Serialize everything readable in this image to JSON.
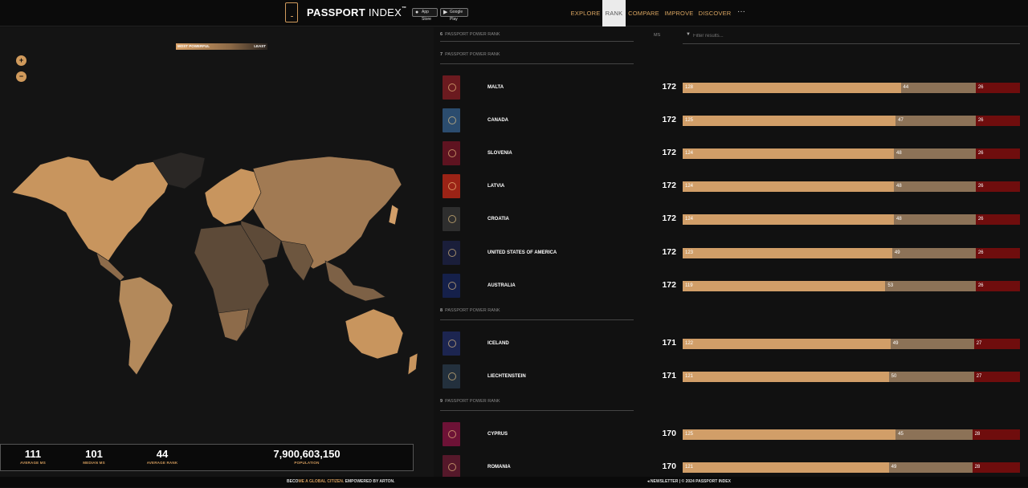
{
  "header": {
    "logo_main": "PASSPORT",
    "logo_light": " INDEX",
    "logo_tm": "™",
    "app_store": "App Store",
    "google_play": "Google Play",
    "nav": [
      "EXPLORE",
      "RANK",
      "COMPARE",
      "IMPROVE",
      "DISCOVER"
    ],
    "nav_active": "RANK",
    "more": "···"
  },
  "map": {
    "zoom_in": "+",
    "zoom_out": "−",
    "legend_left": "MOST POWERFUL",
    "legend_right": "LEAST"
  },
  "stats": [
    {
      "value": "111",
      "label": "AVERAGE MS"
    },
    {
      "value": "101",
      "label": "MEDIAN MS"
    },
    {
      "value": "44",
      "label": "AVERAGE RANK"
    },
    {
      "value": "7,900,603,150",
      "label": "POPULATION"
    }
  ],
  "rank": {
    "ms_header": "MS",
    "filter_placeholder": "Filter results...",
    "groups": [
      {
        "rank": "6",
        "label": "PASSPORT POWER RANK"
      },
      {
        "rank": "7",
        "label": "PASSPORT POWER RANK"
      },
      {
        "rank": "8",
        "label": "PASSPORT POWER RANK"
      },
      {
        "rank": "9",
        "label": "PASSPORT POWER RANK"
      }
    ],
    "rows": [
      {
        "country": "MALTA",
        "ms": "172",
        "vf": "128",
        "va": "44",
        "vr": "26",
        "color": "#6b1a1f"
      },
      {
        "country": "CANADA",
        "ms": "172",
        "vf": "125",
        "va": "47",
        "vr": "26",
        "color": "#2b4c6e"
      },
      {
        "country": "SLOVENIA",
        "ms": "172",
        "vf": "124",
        "va": "48",
        "vr": "26",
        "color": "#5e1320"
      },
      {
        "country": "LATVIA",
        "ms": "172",
        "vf": "124",
        "va": "48",
        "vr": "26",
        "color": "#9b2316"
      },
      {
        "country": "CROATIA",
        "ms": "172",
        "vf": "124",
        "va": "48",
        "vr": "26",
        "color": "#2e2e2e"
      },
      {
        "country": "UNITED STATES OF AMERICA",
        "ms": "172",
        "vf": "123",
        "va": "49",
        "vr": "26",
        "color": "#1a1e3a"
      },
      {
        "country": "AUSTRALIA",
        "ms": "172",
        "vf": "119",
        "va": "53",
        "vr": "26",
        "color": "#15204a"
      },
      {
        "country": "ICELAND",
        "ms": "171",
        "vf": "122",
        "va": "49",
        "vr": "27",
        "color": "#1c2550"
      },
      {
        "country": "LIECHTENSTEIN",
        "ms": "171",
        "vf": "121",
        "va": "50",
        "vr": "27",
        "color": "#23303d"
      },
      {
        "country": "CYPRUS",
        "ms": "170",
        "vf": "125",
        "va": "45",
        "vr": "28",
        "color": "#6d1236"
      },
      {
        "country": "ROMANIA",
        "ms": "170",
        "vf": "121",
        "va": "49",
        "vr": "28",
        "color": "#55182a"
      }
    ]
  },
  "footer": {
    "become_pre": "BECO",
    "become_hl": "ME A GLOBAL CITIZEN.",
    "empowered": " EMPOWERED BY ",
    "arton": "ARTON.",
    "newsletter": "NEWSLETTER",
    "copyright": " | © 2024 PASSPORT INDEX"
  }
}
